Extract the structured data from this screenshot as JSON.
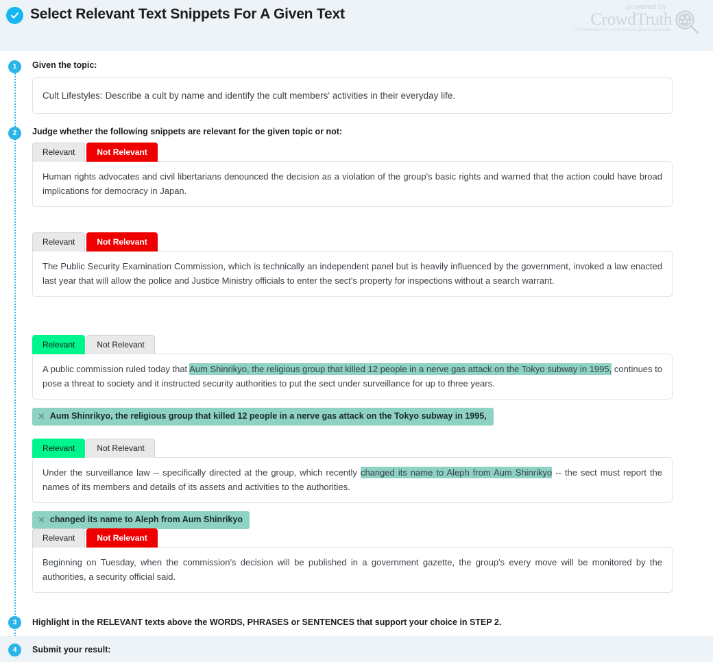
{
  "header": {
    "title": "Select Relevant Text Snippets For A Given Text",
    "check_icon": "check-circle-icon",
    "logo": {
      "powered_by": "powered by",
      "name": "CrowdTruth",
      "tagline": "The framework for crowdsourcing ground truth data",
      "icon": "magnifier-crowd-icon"
    },
    "accent_color": "#16b6f0",
    "background_color": "#eef3f7"
  },
  "steps": [
    {
      "number": "1",
      "label": "Given the topic:"
    },
    {
      "number": "2",
      "label": "Judge whether the following snippets are relevant for the given topic or not:"
    },
    {
      "number": "3",
      "label": "Highlight in the RELEVANT texts above the WORDS, PHRASES or SENTENCES that support your choice in STEP 2."
    },
    {
      "number": "4",
      "label": "Submit your result:"
    }
  ],
  "topic": {
    "value": "Cult Lifestyles: Describe a cult by name and identify the cult members' activities in their everyday life."
  },
  "buttons": {
    "relevant_label": "Relevant",
    "not_relevant_label": "Not Relevant",
    "selected_green": "#00f58c",
    "selected_red": "#ef0000",
    "unselected_gray": "#e9e9e9"
  },
  "highlight_color": "#8dd2c2",
  "snippets": [
    {
      "id": "snippet-1",
      "selection": "not_relevant",
      "parts": [
        {
          "text": "Human rights advocates and civil libertarians denounced the decision as a violation of the group's basic rights and warned that the action could have broad implications for democracy in Japan.",
          "highlighted": false
        }
      ]
    },
    {
      "id": "snippet-2",
      "selection": "not_relevant",
      "parts": [
        {
          "text": "The Public Security Examination Commission, which is technically an independent panel but is heavily influenced by the government, invoked a law enacted last year that will allow the police and Justice Ministry officials to enter the sect's property for inspections without a search warrant.",
          "highlighted": false
        }
      ]
    },
    {
      "id": "snippet-3",
      "selection": "relevant",
      "parts": [
        {
          "text": "A public commission ruled today that ",
          "highlighted": false
        },
        {
          "text": "Aum Shinrikyo, the religious group that killed 12 people in a nerve gas attack on the Tokyo subway in 1995,",
          "highlighted": true
        },
        {
          "text": " continues to pose a threat to society and it instructed security authorities to put the sect under surveillance for up to three years.",
          "highlighted": false
        }
      ],
      "tag": {
        "close_icon": "close-x-icon",
        "text": "Aum Shinrikyo, the religious group that killed 12 people in a nerve gas attack on the Tokyo subway in 1995,"
      }
    },
    {
      "id": "snippet-4",
      "selection": "relevant",
      "parts": [
        {
          "text": "Under the surveillance law -- specifically directed at the group, which recently ",
          "highlighted": false
        },
        {
          "text": "changed its name to Aleph from Aum Shinrikyo",
          "highlighted": true
        },
        {
          "text": " -- the sect must report the names of its members and details of its assets and activities to the authorities.",
          "highlighted": false
        }
      ],
      "tag": {
        "close_icon": "close-x-icon",
        "text": "changed its name to Aleph from Aum Shinrikyo"
      }
    },
    {
      "id": "snippet-5",
      "selection": "not_relevant",
      "parts": [
        {
          "text": "Beginning on Tuesday, when the commission's decision will be published in a government gazette, the group's every move will be monitored by the authorities, a security official said.",
          "highlighted": false
        }
      ]
    }
  ]
}
